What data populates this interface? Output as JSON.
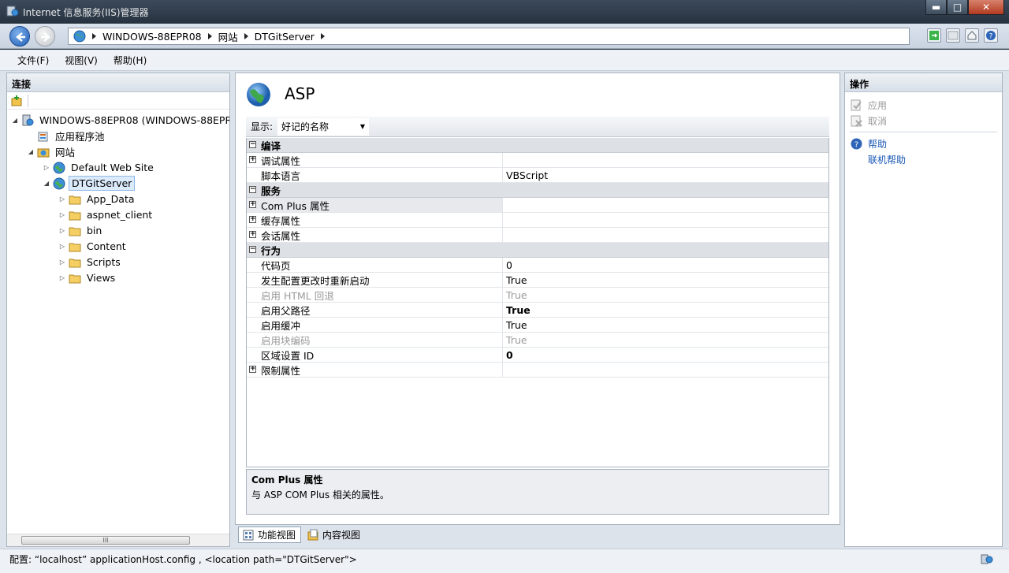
{
  "window": {
    "title": "Internet 信息服务(IIS)管理器",
    "minimize": "▬",
    "maximize": "□",
    "close": "✕"
  },
  "breadcrumb": [
    "WINDOWS-88EPR08",
    "网站",
    "DTGitServer"
  ],
  "menu": [
    "文件(F)",
    "视图(V)",
    "帮助(H)"
  ],
  "connections": {
    "header": "连接",
    "tree": [
      {
        "label": "WINDOWS-88EPR08 (WINDOWS-88EPR0",
        "depth": 0,
        "icon": "server-icon",
        "expander": "◢"
      },
      {
        "label": "应用程序池",
        "depth": 1,
        "icon": "app-pool-icon",
        "expander": ""
      },
      {
        "label": "网站",
        "depth": 1,
        "icon": "sites-folder-icon",
        "expander": "◢"
      },
      {
        "label": "Default Web Site",
        "depth": 2,
        "icon": "globe-icon",
        "expander": "▷"
      },
      {
        "label": "DTGitServer",
        "depth": 2,
        "icon": "globe-icon",
        "expander": "◢",
        "selected": true
      },
      {
        "label": "App_Data",
        "depth": 3,
        "icon": "folder-icon",
        "expander": "▷"
      },
      {
        "label": "aspnet_client",
        "depth": 3,
        "icon": "folder-icon",
        "expander": "▷"
      },
      {
        "label": "bin",
        "depth": 3,
        "icon": "folder-icon",
        "expander": "▷"
      },
      {
        "label": "Content",
        "depth": 3,
        "icon": "folder-icon",
        "expander": "▷"
      },
      {
        "label": "Scripts",
        "depth": 3,
        "icon": "folder-icon",
        "expander": "▷"
      },
      {
        "label": "Views",
        "depth": 3,
        "icon": "folder-icon",
        "expander": "▷"
      }
    ],
    "scroll_grip": "III"
  },
  "feature": {
    "title": "ASP",
    "display_label": "显示:",
    "display_value": "好记的名称",
    "rows": [
      {
        "kind": "cat",
        "name": "编译",
        "sign": "⊟"
      },
      {
        "kind": "prop",
        "name": "调试属性",
        "value": "",
        "sign": "+"
      },
      {
        "kind": "prop",
        "name": "脚本语言",
        "value": "VBScript"
      },
      {
        "kind": "cat",
        "name": "服务",
        "sign": "⊟"
      },
      {
        "kind": "prop",
        "name": "Com Plus 属性",
        "value": "",
        "sign": "+",
        "hl": true
      },
      {
        "kind": "prop",
        "name": "缓存属性",
        "value": "",
        "sign": "+"
      },
      {
        "kind": "prop",
        "name": "会话属性",
        "value": "",
        "sign": "+"
      },
      {
        "kind": "cat",
        "name": "行为",
        "sign": "⊟"
      },
      {
        "kind": "prop",
        "name": "代码页",
        "value": "0"
      },
      {
        "kind": "prop",
        "name": "发生配置更改时重新启动",
        "value": "True"
      },
      {
        "kind": "prop",
        "name": "启用 HTML 回退",
        "value": "True",
        "dim": true
      },
      {
        "kind": "prop",
        "name": "启用父路径",
        "value": "True",
        "bold": true
      },
      {
        "kind": "prop",
        "name": "启用缓冲",
        "value": "True"
      },
      {
        "kind": "prop",
        "name": "启用块编码",
        "value": "True",
        "dim": true
      },
      {
        "kind": "prop",
        "name": "区域设置 ID",
        "value": "0",
        "bold": true
      },
      {
        "kind": "prop",
        "name": "限制属性",
        "value": "",
        "sign": "+"
      }
    ],
    "description_title": "Com Plus 属性",
    "description_text": "与 ASP COM Plus 相关的属性。"
  },
  "view_tabs": {
    "features": "功能视图",
    "content": "内容视图"
  },
  "actions": {
    "header": "操作",
    "apply": "应用",
    "cancel": "取消",
    "help": "帮助",
    "online_help": "联机帮助"
  },
  "status": "配置: “localhost” applicationHost.config , <location path=\"DTGitServer\">",
  "colors": {
    "link": "#1a57b4",
    "selection": "#dcebfc"
  }
}
